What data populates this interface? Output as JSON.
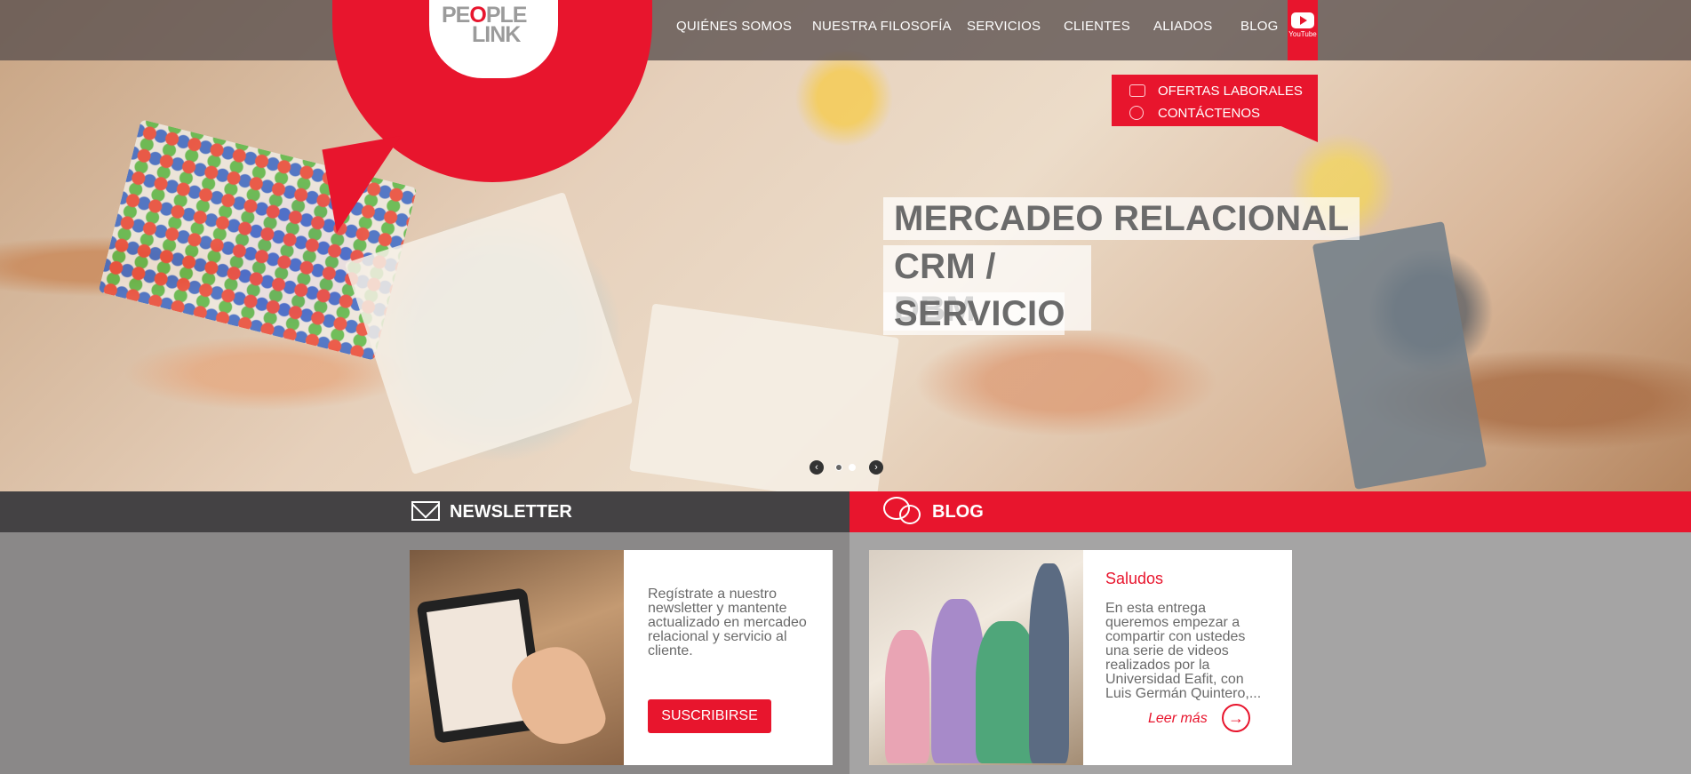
{
  "brand": {
    "logo_line1_a": "PE",
    "logo_line1_o": "O",
    "logo_line1_b": "PLE",
    "logo_line2": "LINK"
  },
  "nav": {
    "items": [
      {
        "label": "QUIÉNES SOMOS"
      },
      {
        "label": "NUESTRA FILOSOFÍA"
      },
      {
        "label": "SERVICIOS"
      },
      {
        "label": "CLIENTES"
      },
      {
        "label": "ALIADOS"
      },
      {
        "label": "BLOG"
      }
    ],
    "youtube_label": "YouTube"
  },
  "quick_links": {
    "jobs": "OFERTAS LABORALES",
    "contact": "CONTÁCTENOS"
  },
  "hero": {
    "slides": [
      "MERCADEO RELACIONAL",
      "CRM / DBM",
      "SERVICIO"
    ],
    "prev": "‹",
    "next": "›"
  },
  "newsletter": {
    "title": "NEWSLETTER",
    "text_lines": [
      "Regístrate a nuestro",
      "newsletter y mantente",
      "actualizado en mercadeo",
      "relacional y servicio al",
      "cliente."
    ],
    "button": "SUSCRIBIRSE"
  },
  "blog": {
    "title": "BLOG",
    "post_title": "Saludos",
    "excerpt_lines": [
      "En esta entrega",
      "queremos empezar a",
      "compartir con ustedes",
      "una serie de videos",
      "realizados por la",
      "Universidad Eafit, con",
      "Luis Germán Quintero,..."
    ],
    "read_more": "Leer más",
    "read_more_icon": "→"
  },
  "colors": {
    "accent": "#e8152d",
    "dark_bar": "#444244",
    "text_gray": "#6b6b6b"
  }
}
